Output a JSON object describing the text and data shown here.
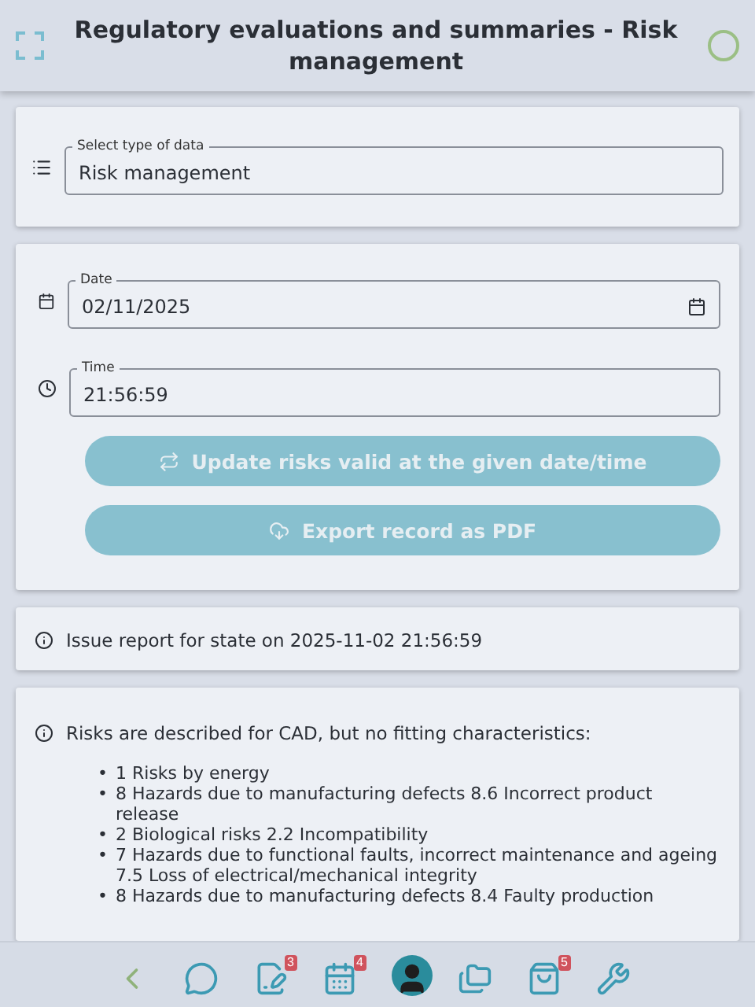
{
  "header": {
    "title": "Regulatory evaluations and summaries - Risk management"
  },
  "data_type": {
    "label": "Select type of data",
    "value": "Risk management"
  },
  "date": {
    "label": "Date",
    "value": "02/11/2025"
  },
  "time": {
    "label": "Time",
    "value": "21:56:59"
  },
  "buttons": [
    {
      "kind": "update",
      "label": "Update risks valid at the given date/time",
      "disabled": true
    },
    {
      "kind": "export",
      "label": "Export record as PDF",
      "disabled": true
    }
  ],
  "report": {
    "text": "Issue report for state on 2025-11-02 21:56:59"
  },
  "risks": {
    "text": "Risks are described for CAD, but no fitting characteristics:",
    "items": [
      {
        "marker": "•",
        "text": "1 Risks by energy"
      },
      {
        "marker": "•",
        "text": "8 Hazards due to manufacturing defects 8.6 Incorrect product release"
      },
      {
        "marker": "•",
        "text": "2 Biological risks 2.2 Incompatibility"
      },
      {
        "marker": "•",
        "text": "7 Hazards due to functional faults, incorrect maintenance and ageing 7.5 Loss of electrical/mechanical integrity"
      },
      {
        "marker": "•",
        "text": "8 Hazards due to manufacturing defects 8.4 Faulty production"
      }
    ]
  },
  "nav": [
    {
      "kind": "back"
    },
    {
      "kind": "chat"
    },
    {
      "kind": "document",
      "badge": "3"
    },
    {
      "kind": "calendar",
      "badge": "4"
    },
    {
      "kind": "avatar"
    },
    {
      "kind": "folders"
    },
    {
      "kind": "bag",
      "badge": "5"
    },
    {
      "kind": "tools"
    }
  ]
}
